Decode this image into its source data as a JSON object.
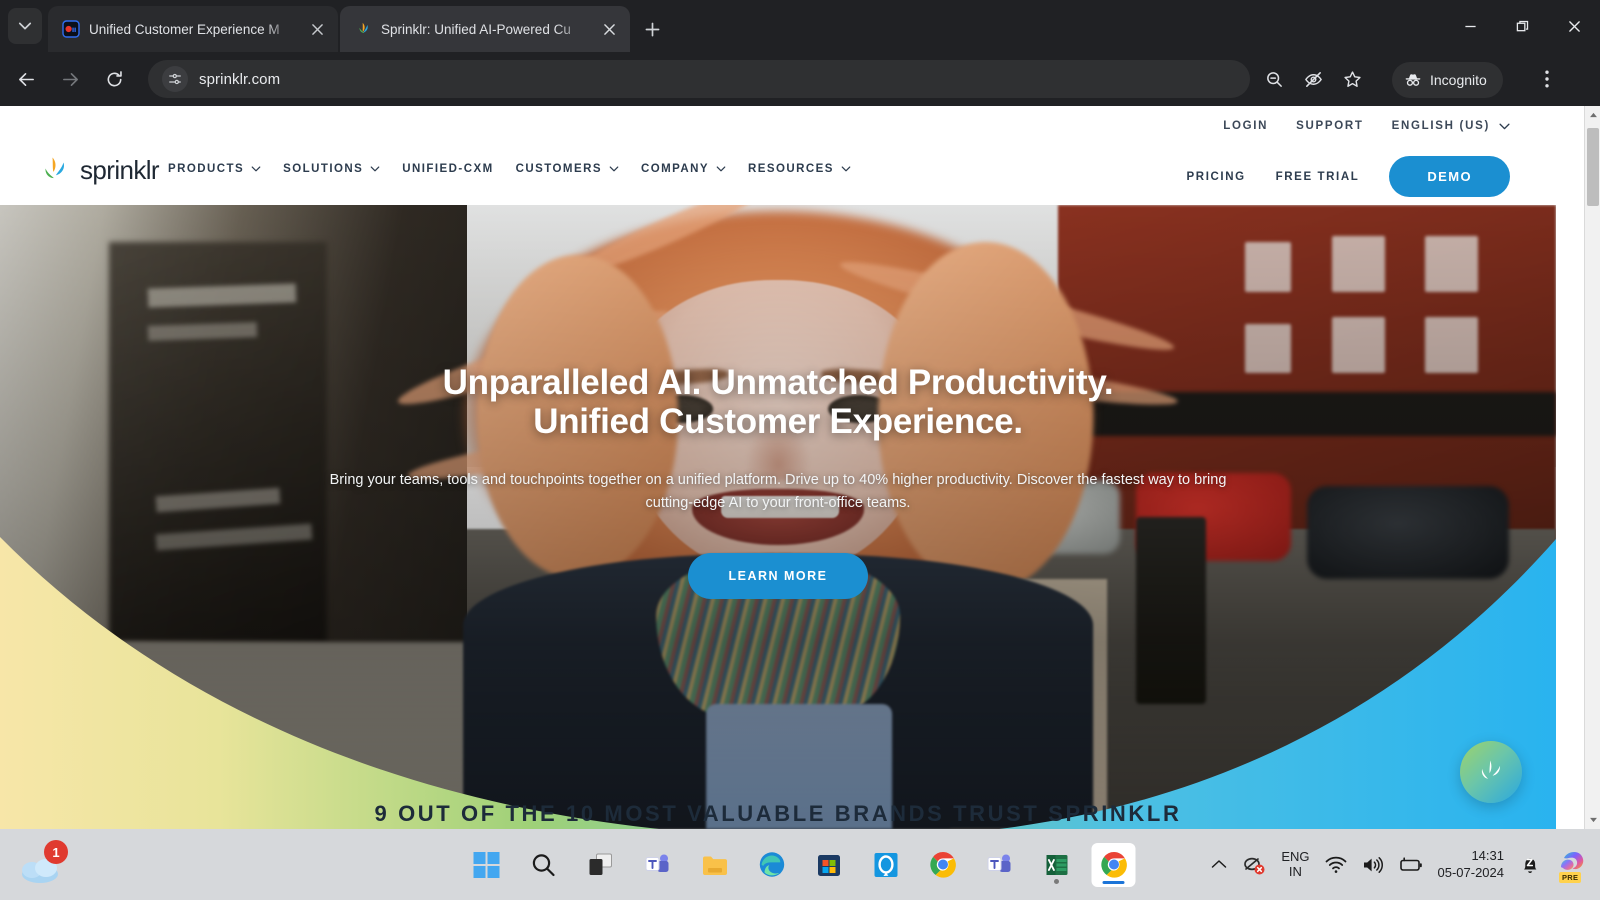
{
  "browser": {
    "tabs": [
      {
        "title": "Unified Customer Experience M",
        "favicon": "qm-logo-icon",
        "active": false
      },
      {
        "title": "Sprinklr: Unified AI-Powered Cu",
        "favicon": "sprinklr-leaf-icon",
        "active": true
      }
    ],
    "tab_list_icon": "chevron-down-icon",
    "new_tab_icon": "plus-icon",
    "window_controls": {
      "minimize": "minimize-icon",
      "maximize": "restore-icon",
      "close": "close-icon"
    },
    "nav": {
      "back": "arrow-left-icon",
      "forward": "arrow-right-icon",
      "reload": "reload-icon"
    },
    "omnibox": {
      "site_info_icon": "tune-settings-icon",
      "url": "sprinklr.com"
    },
    "actions": {
      "zoom_out_icon": "zoom-out-icon",
      "tracking_protection_icon": "eye-off-icon",
      "bookmark_icon": "star-icon",
      "incognito_label": "Incognito",
      "incognito_icon": "incognito-hat-icon",
      "menu_icon": "kebab-menu-icon"
    }
  },
  "site": {
    "brand": "sprinklr",
    "utility_links": [
      "LOGIN",
      "SUPPORT"
    ],
    "language": "ENGLISH (US)",
    "nav_items": [
      {
        "label": "PRODUCTS",
        "has_dropdown": true
      },
      {
        "label": "SOLUTIONS",
        "has_dropdown": true
      },
      {
        "label": "UNIFIED-CXM",
        "has_dropdown": false
      },
      {
        "label": "CUSTOMERS",
        "has_dropdown": true
      },
      {
        "label": "COMPANY",
        "has_dropdown": true
      },
      {
        "label": "RESOURCES",
        "has_dropdown": true
      }
    ],
    "cta_links": [
      "PRICING",
      "FREE TRIAL"
    ],
    "demo_button": "DEMO",
    "hero": {
      "headline_line1": "Unparalleled AI. Unmatched Productivity.",
      "headline_line2": "Unified Customer Experience.",
      "subtext": "Bring your teams, tools and touchpoints together on a unified platform. Drive up to 40% higher productivity. Discover the fastest way to bring cutting-edge AI to your front-office teams.",
      "cta": "LEARN MORE"
    },
    "trust_heading": "9 OUT OF THE 10 MOST VALUABLE BRANDS TRUST SPRINKLR",
    "chat_widget_icon": "sprinklr-leaf-icon",
    "colors": {
      "accent_blue": "#1b8fd1",
      "wave_left": "#f3d98a",
      "wave_mid": "#8fc96b",
      "wave_right": "#2ab6ee"
    },
    "scrollbar": {
      "up_icon": "caret-up-icon",
      "down_icon": "caret-down-icon"
    }
  },
  "taskbar": {
    "weather_badge": "1",
    "weather_icon": "cloud-weather-icon",
    "apps": [
      {
        "name": "start-button",
        "icon": "windows-logo-icon"
      },
      {
        "name": "search-button",
        "icon": "search-icon"
      },
      {
        "name": "task-view-button",
        "icon": "task-view-icon"
      },
      {
        "name": "teams-chat-button",
        "icon": "teams-icon"
      },
      {
        "name": "file-explorer-button",
        "icon": "folder-icon"
      },
      {
        "name": "edge-button",
        "icon": "edge-icon"
      },
      {
        "name": "microsoft-store-button",
        "icon": "store-icon"
      },
      {
        "name": "halo-app-button",
        "icon": "blue-circle-icon"
      },
      {
        "name": "chrome-button",
        "icon": "chrome-icon"
      },
      {
        "name": "teams-classic-button",
        "icon": "teams-icon"
      },
      {
        "name": "excel-button",
        "icon": "excel-icon"
      },
      {
        "name": "chrome-active-button",
        "icon": "chrome-icon"
      }
    ],
    "tray": {
      "overflow_icon": "chevron-up-icon",
      "mic_error_icon": "mic-muted-error-icon",
      "language_line1": "ENG",
      "language_line2": "IN",
      "wifi_icon": "wifi-icon",
      "volume_icon": "speaker-icon",
      "battery_icon": "battery-charging-icon",
      "time": "14:31",
      "date": "05-07-2024",
      "notification_icon": "bell-quiet-icon",
      "copilot_icon": "copilot-icon",
      "copilot_badge": "PRE"
    }
  }
}
